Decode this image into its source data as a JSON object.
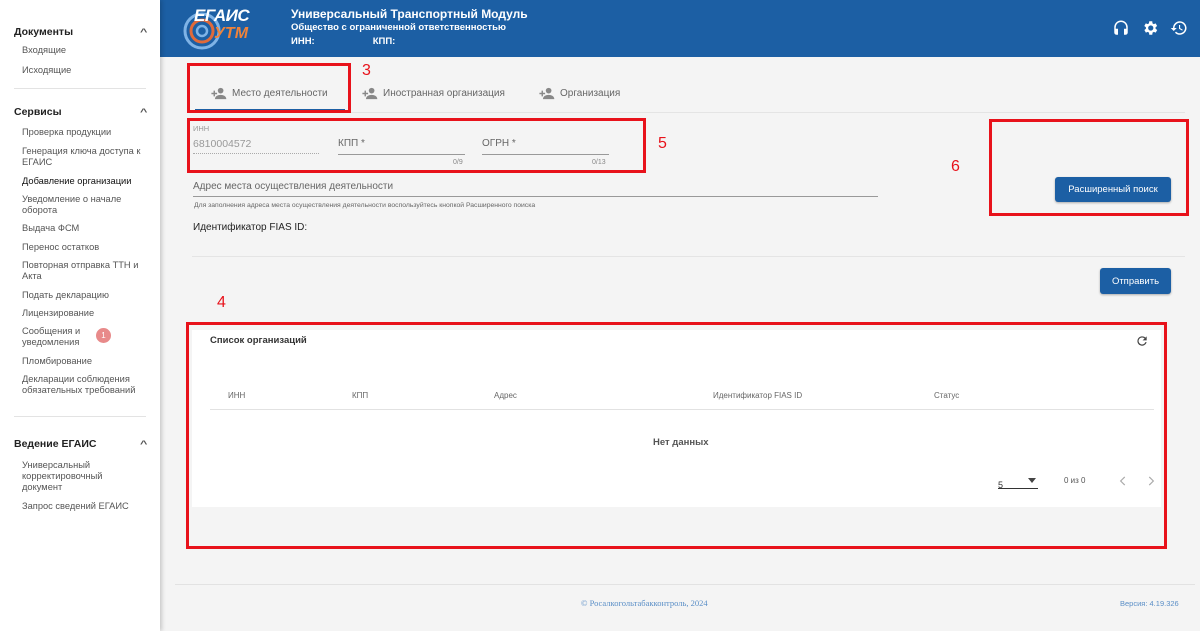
{
  "sidebar": {
    "sections": [
      {
        "title": "Документы",
        "items": [
          "Входящие",
          "Исходящие"
        ]
      },
      {
        "title": "Сервисы",
        "items": [
          "Проверка продукции",
          "Генерация ключа доступа к ЕГАИС",
          "Добавление организации",
          "Уведомление о начале оборота",
          "Выдача ФСМ",
          "Перенос остатков",
          "Повторная отправка ТТН и Акта",
          "Подать декларацию",
          "Лицензирование",
          "Сообщения и уведомления",
          "Пломбирование",
          "Декларации соблюдения обязательных требований"
        ],
        "messages_badge": "1"
      },
      {
        "title": "Ведение ЕГАИС",
        "items": [
          "Универсальный корректировочный документ",
          "Запрос сведений ЕГАИС"
        ]
      }
    ]
  },
  "header": {
    "logo_top": "ЕГАИС",
    "logo_bottom": "УТМ",
    "title": "Универсальный Транспортный Модуль",
    "org": "Общество с ограниченной ответственностью",
    "inn_label": "ИНН:",
    "kpp_label": "КПП:",
    "icons": [
      "headset-icon",
      "gear-icon",
      "history-icon"
    ]
  },
  "tabs": [
    "Место деятельности",
    "Иностранная организация",
    "Организация"
  ],
  "form": {
    "inn_label": "ИНН",
    "inn_value": "6810004572",
    "kpp_placeholder": "КПП *",
    "kpp_counter": "0/9",
    "ogrn_placeholder": "ОГРН *",
    "ogrn_counter": "0/13",
    "address_placeholder": "Адрес места осуществления деятельности",
    "address_hint": "Для заполнения адреса места осуществления деятельности воспользуйтесь кнопкой Расширенного поиска",
    "fias_label": "Идентификатор FIAS ID:",
    "advanced_search_label": "Расширенный поиск",
    "submit_label": "Отправить"
  },
  "table": {
    "title": "Список организаций",
    "columns": [
      "ИНН",
      "КПП",
      "Адрес",
      "Идентификатор FIAS ID",
      "Статус"
    ],
    "empty_text": "Нет данных",
    "page_size": "5",
    "range_text": "0 из 0"
  },
  "annotations": [
    "3",
    "5",
    "6",
    "4"
  ],
  "footer": {
    "copyright": "© Росалкогольтабакконтроль, 2024",
    "version": "Версия: 4.19.326"
  },
  "colors": {
    "brand_blue": "#1c5fa4",
    "annotation_red": "#e8121b",
    "badge_pink": "#e88a8a"
  }
}
